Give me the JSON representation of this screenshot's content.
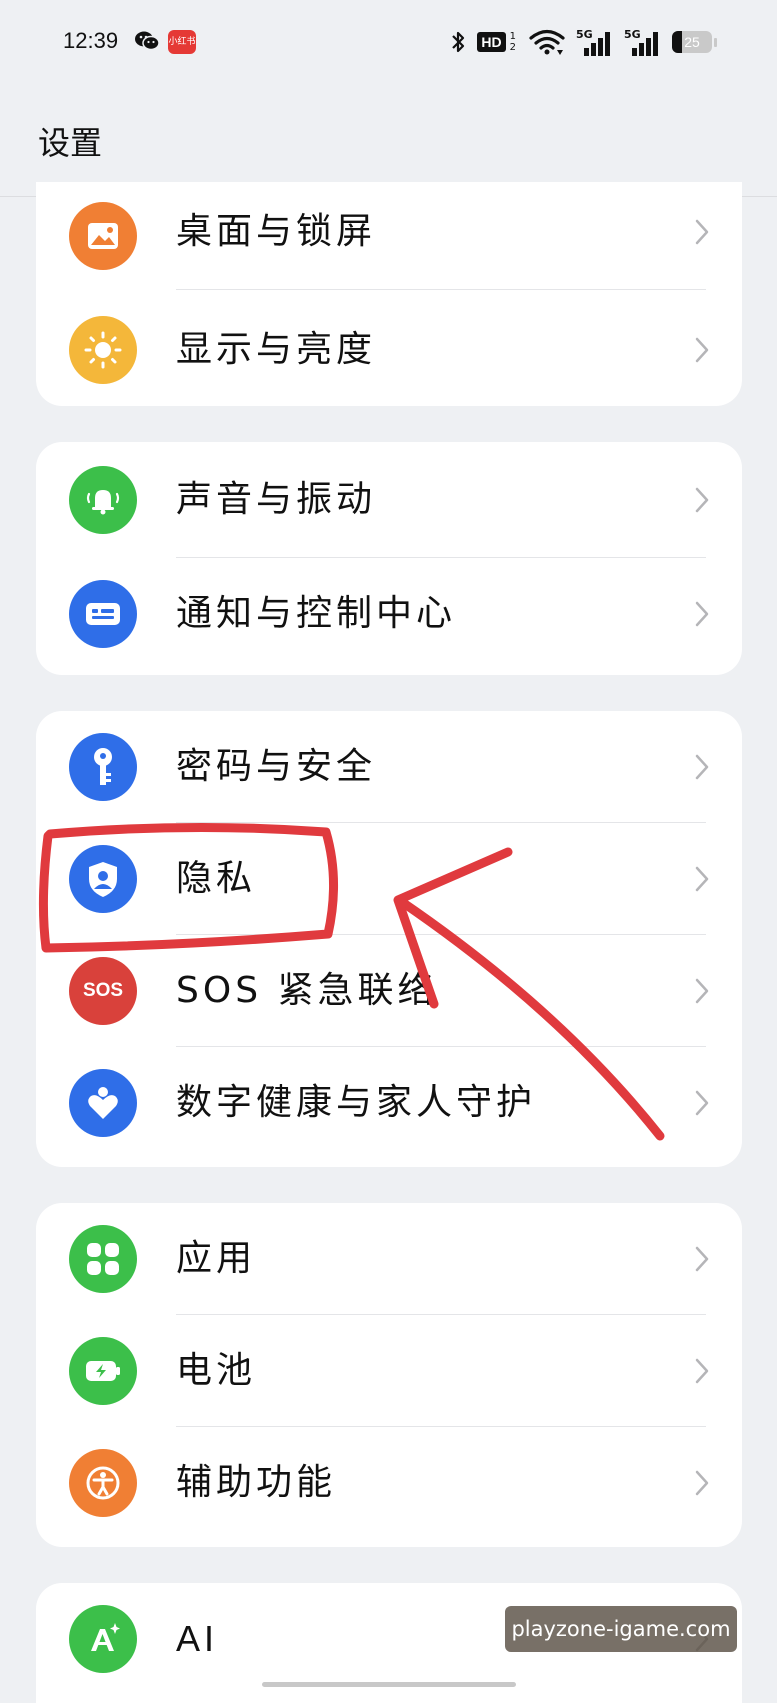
{
  "status_bar": {
    "time": "12:39",
    "app_badge": "小红书",
    "hd_label": "HD",
    "hd_sub": [
      "1",
      "2"
    ],
    "signal1_label": "5G",
    "signal2_label": "5G",
    "battery_level": 25,
    "battery_text": "25"
  },
  "header": {
    "title": "设置"
  },
  "colors": {
    "background": "#eef0f3",
    "card": "#ffffff",
    "orange": "#f07f34",
    "yellow": "#f4b73a",
    "green": "#3cbf4a",
    "blue": "#2f6ee8",
    "red": "#d9413b",
    "annotation": "#e03a3e"
  },
  "groups": [
    {
      "items": [
        {
          "label": "桌面与锁屏",
          "icon": "wallpaper-icon",
          "color": "#f07f34"
        },
        {
          "label": "显示与亮度",
          "icon": "sun-icon",
          "color": "#f4b73a"
        }
      ]
    },
    {
      "items": [
        {
          "label": "声音与振动",
          "icon": "bell-icon",
          "color": "#3cbf4a"
        },
        {
          "label": "通知与控制中心",
          "icon": "notification-icon",
          "color": "#2f6ee8"
        }
      ]
    },
    {
      "items": [
        {
          "label": "密码与安全",
          "icon": "key-icon",
          "color": "#2f6ee8"
        },
        {
          "label": "隐私",
          "icon": "privacy-shield-icon",
          "color": "#2f6ee8"
        },
        {
          "label": "SOS 紧急联络",
          "icon": "sos-icon",
          "icon_text": "SOS",
          "color": "#d9413b"
        },
        {
          "label": "数字健康与家人守护",
          "icon": "heart-person-icon",
          "color": "#2f6ee8"
        }
      ]
    },
    {
      "items": [
        {
          "label": "应用",
          "icon": "apps-grid-icon",
          "color": "#3cbf4a"
        },
        {
          "label": "电池",
          "icon": "battery-icon",
          "color": "#3cbf4a"
        },
        {
          "label": "辅助功能",
          "icon": "accessibility-icon",
          "color": "#f07f34"
        }
      ]
    },
    {
      "items": [
        {
          "label": "AI",
          "icon": "ai-sparkle-icon",
          "color": "#3cbf4a"
        }
      ]
    }
  ],
  "watermark": "playzone-igame.com"
}
